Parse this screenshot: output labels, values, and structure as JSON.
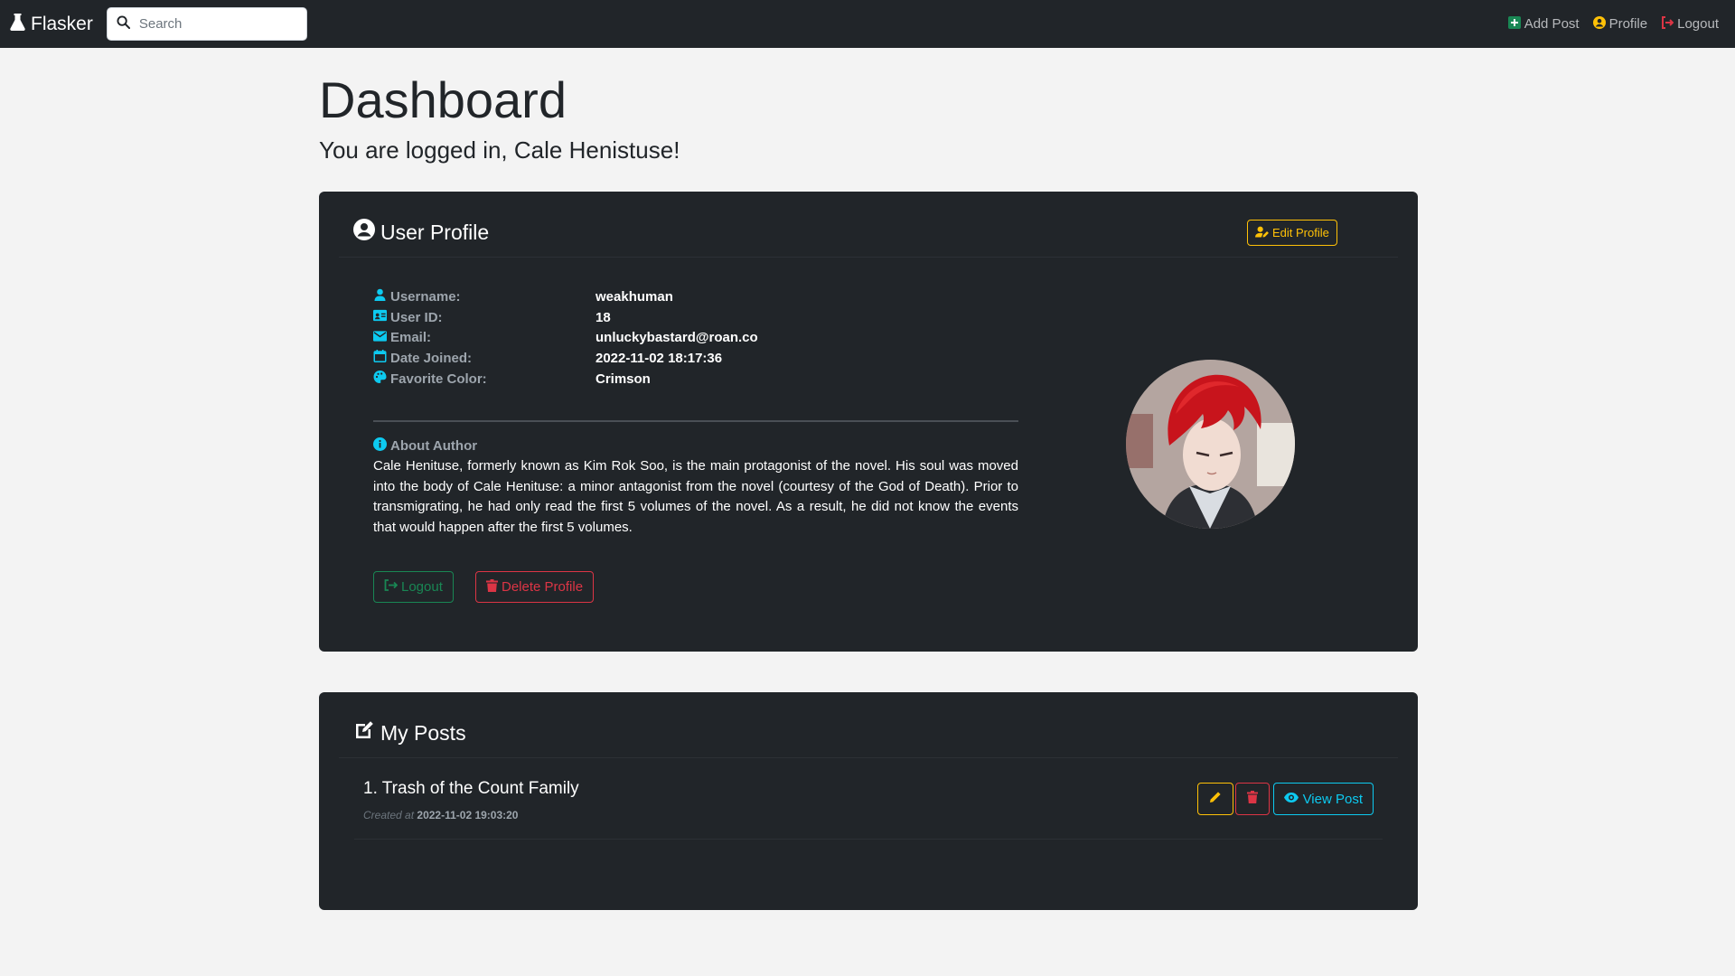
{
  "navbar": {
    "brand": "Flasker",
    "search_placeholder": "Search",
    "links": {
      "add_post": "Add Post",
      "profile": "Profile",
      "logout": "Logout"
    }
  },
  "header": {
    "title": "Dashboard",
    "subtitle": "You are logged in, Cale Henistuse!"
  },
  "profile_card": {
    "title": "User Profile",
    "edit_label": "Edit Profile",
    "fields": {
      "username_label": "Username:",
      "username": "weakhuman",
      "userid_label": "User ID:",
      "userid": "18",
      "email_label": "Email:",
      "email": "unluckybastard@roan.co",
      "joined_label": "Date Joined:",
      "joined": "2022-11-02 18:17:36",
      "color_label": "Favorite Color:",
      "color": "Crimson"
    },
    "about_label": "About Author",
    "about_text": "Cale Henituse, formerly known as Kim Rok Soo, is the main protagonist of the novel. His soul was moved into the body of Cale Henituse: a minor antagonist from the novel (courtesy of the God of Death). Prior to transmigrating, he had only read the first 5 volumes of the novel. As a result, he did not know the events that would happen after the first 5 volumes.",
    "logout_label": "Logout",
    "delete_label": "Delete Profile"
  },
  "posts_card": {
    "title": "My Posts",
    "posts": [
      {
        "title": "1. Trash of the Count Family",
        "created_prefix": "Created at",
        "created": "2022-11-02 19:03:20",
        "view_label": "View Post"
      }
    ]
  },
  "colors": {
    "navbar_bg": "#212529",
    "card_bg": "#212529",
    "warning": "#ffc107",
    "danger": "#dc3545",
    "success": "#198754",
    "info": "#0dcaf0"
  }
}
